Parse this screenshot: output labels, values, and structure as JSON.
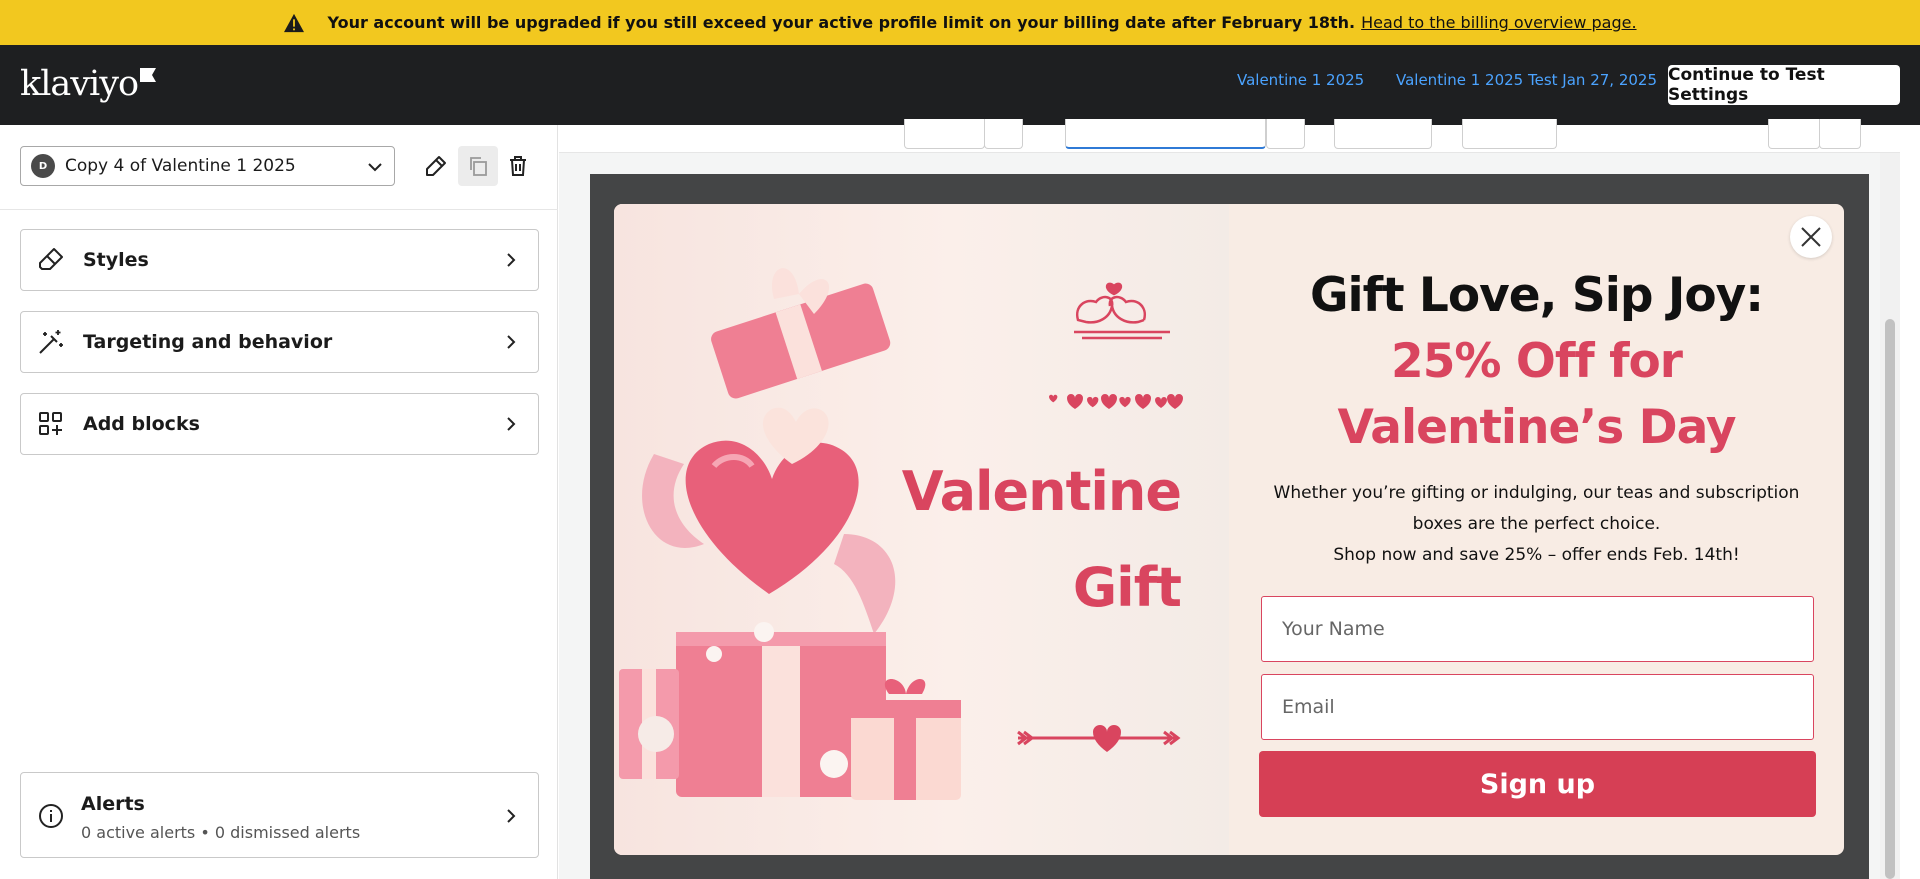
{
  "banner": {
    "message": "Your account will be upgraded if you still exceed your active profile limit on your billing date after February 18th.",
    "link": "Head to the billing overview page."
  },
  "header": {
    "logo": "klaviyo",
    "link1": "Valentine 1 2025",
    "link2": "Valentine 1 2025 Test Jan 27, 2025",
    "button": "Continue to Test Settings"
  },
  "left": {
    "select_avatar": "D",
    "select_value": "Copy 4 of Valentine 1 2025",
    "cards": [
      {
        "label": "Styles"
      },
      {
        "label": "Targeting and behavior"
      },
      {
        "label": "Add blocks"
      }
    ],
    "alerts": {
      "title": "Alerts",
      "summary": "0 active alerts • 0 dismissed alerts"
    }
  },
  "popup": {
    "image_text_1": "Valentine",
    "image_text_2": "Gift",
    "headline_1": "Gift Love, Sip Joy:",
    "headline_2": "25% Off for",
    "headline_3": "Valentine’s Day",
    "body_1": "Whether you’re gifting or indulging, our teas and subscription boxes are the perfect choice.",
    "body_2": "Shop now and save 25% – offer ends Feb. 14th!",
    "name_placeholder": "Your Name",
    "email_placeholder": "Email",
    "signup_label": "Sign up",
    "accent_color": "#d9455f"
  },
  "colors": {
    "banner_bg": "#f2c81f",
    "header_bg": "#1e1f21",
    "link": "#4ba3ff",
    "stage_bg": "#444546"
  }
}
